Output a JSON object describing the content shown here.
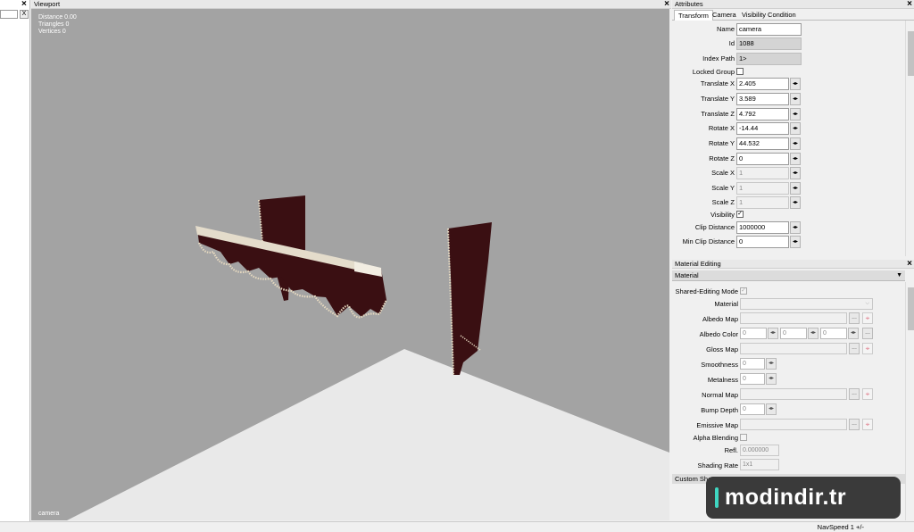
{
  "left_panel": {
    "clear_label": "X"
  },
  "viewport": {
    "title": "Viewport",
    "stats": {
      "distance": "Distance 0.00",
      "triangles": "Triangles 0",
      "vertices": "Vertices 0"
    },
    "camera_label": "camera"
  },
  "attributes": {
    "title": "Attributes",
    "tabs": [
      "Transform",
      "Camera",
      "Visibility Condition"
    ],
    "rows": {
      "name": {
        "label": "Name",
        "value": "camera"
      },
      "id": {
        "label": "Id",
        "value": "1088"
      },
      "index_path": {
        "label": "Index Path",
        "value": "1>"
      },
      "locked_group": {
        "label": "Locked Group"
      },
      "translate_x": {
        "label": "Translate X",
        "value": "2.405"
      },
      "translate_y": {
        "label": "Translate Y",
        "value": "3.589"
      },
      "translate_z": {
        "label": "Translate Z",
        "value": "4.792"
      },
      "rotate_x": {
        "label": "Rotate X",
        "value": "-14.44"
      },
      "rotate_y": {
        "label": "Rotate Y",
        "value": "44.532"
      },
      "rotate_z": {
        "label": "Rotate Z",
        "value": "0"
      },
      "scale_x": {
        "label": "Scale X",
        "value": "1"
      },
      "scale_y": {
        "label": "Scale Y",
        "value": "1"
      },
      "scale_z": {
        "label": "Scale Z",
        "value": "1"
      },
      "visibility": {
        "label": "Visibility",
        "checked": true
      },
      "clip_distance": {
        "label": "Clip Distance",
        "value": "1000000"
      },
      "min_clip_distance": {
        "label": "Min Clip Distance",
        "value": "0"
      }
    }
  },
  "material_editing": {
    "title": "Material Editing",
    "section": "Material",
    "rows": {
      "shared_editing": {
        "label": "Shared-Editing Mode",
        "checked": true
      },
      "material": {
        "label": "Material"
      },
      "albedo_map": {
        "label": "Albedo Map"
      },
      "albedo_color": {
        "label": "Albedo Color",
        "r": "0",
        "g": "0",
        "b": "0"
      },
      "gloss_map": {
        "label": "Gloss Map"
      },
      "smoothness": {
        "label": "Smoothness",
        "value": "0"
      },
      "metalness": {
        "label": "Metalness",
        "value": "0"
      },
      "normal_map": {
        "label": "Normal Map"
      },
      "bump_depth": {
        "label": "Bump Depth",
        "value": "0"
      },
      "emissive_map": {
        "label": "Emissive Map"
      },
      "alpha_blending": {
        "label": "Alpha Blending"
      },
      "refl": {
        "label": "Refl.",
        "value": "0.000000"
      },
      "shading_rate": {
        "label": "Shading Rate",
        "value": "1x1"
      }
    },
    "custom_shader": "Custom Sha..."
  },
  "statusbar": {
    "navspeed": "NavSpeed 1 +/-"
  },
  "watermark": {
    "text": "modindir.tr"
  },
  "colors": {
    "viewport_bg": "#a3a3a3",
    "floor": "#e9e9e9",
    "curtain": "#3a0f12",
    "fringe": "#e6d9c0"
  }
}
